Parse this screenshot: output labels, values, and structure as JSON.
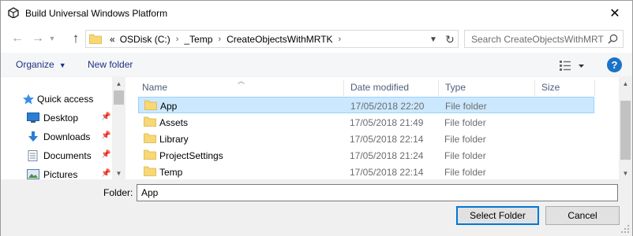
{
  "window": {
    "title": "Build Universal Windows Platform",
    "close_glyph": "✕"
  },
  "address": {
    "overflow_glyph": "«",
    "crumbs": [
      "OSDisk (C:)",
      "_Temp",
      "CreateObjectsWithMRTK"
    ],
    "separator": "›"
  },
  "search": {
    "placeholder": "Search CreateObjectsWithMRTK"
  },
  "commands": {
    "organize": "Organize",
    "new_folder": "New folder",
    "help": "?"
  },
  "navpane": {
    "items": [
      {
        "label": "Quick access",
        "icon": "star-icon",
        "pinned": false
      },
      {
        "label": "Desktop",
        "icon": "desktop-icon",
        "pinned": true
      },
      {
        "label": "Downloads",
        "icon": "download-icon",
        "pinned": true
      },
      {
        "label": "Documents",
        "icon": "documents-icon",
        "pinned": true
      },
      {
        "label": "Pictures",
        "icon": "pictures-icon",
        "pinned": true
      }
    ]
  },
  "filelist": {
    "columns": [
      "Name",
      "Date modified",
      "Type",
      "Size"
    ],
    "rows": [
      {
        "name": "App",
        "date": "17/05/2018 22:20",
        "type": "File folder",
        "selected": true
      },
      {
        "name": "Assets",
        "date": "17/05/2018 21:49",
        "type": "File folder",
        "selected": false
      },
      {
        "name": "Library",
        "date": "17/05/2018 22:14",
        "type": "File folder",
        "selected": false
      },
      {
        "name": "ProjectSettings",
        "date": "17/05/2018 21:24",
        "type": "File folder",
        "selected": false
      },
      {
        "name": "Temp",
        "date": "17/05/2018 22:14",
        "type": "File folder",
        "selected": false
      }
    ]
  },
  "footer": {
    "folder_label": "Folder:",
    "folder_value": "App",
    "select_button": "Select Folder",
    "cancel_button": "Cancel"
  },
  "colors": {
    "selection_bg": "#cce8ff",
    "selection_border": "#99d1ff",
    "folder_yellow": "#f8d775",
    "accent_blue": "#0078d7",
    "link_blue": "#1e3287"
  }
}
